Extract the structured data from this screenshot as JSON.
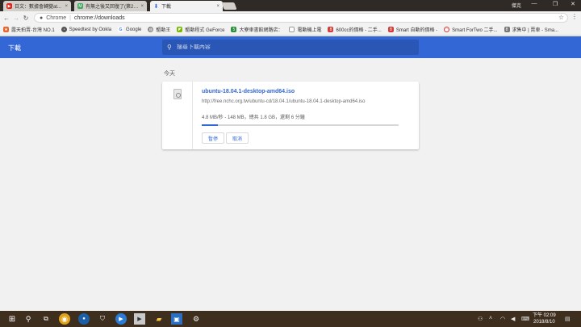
{
  "tabs": [
    {
      "label": "日文：數據會轉變at...",
      "icon": "youtube-icon",
      "color": "#e62117"
    },
    {
      "label": "有無之後又回復了(第2頁)",
      "icon": "forum-icon",
      "color": "#41a85f"
    },
    {
      "label": "下載",
      "icon": "download-icon",
      "color": "#3367d6"
    }
  ],
  "profile": "傑克",
  "address": {
    "scheme": "Chrome",
    "url": "chrome://downloads"
  },
  "bookmarks": [
    {
      "label": "露天拍賣-台灣 NO.1",
      "color": "#e8642c"
    },
    {
      "label": "Speedtest by Ookla",
      "color": "#555555"
    },
    {
      "label": "Google",
      "color": "#4285f4"
    },
    {
      "label": "驅動王",
      "color": "#888888"
    },
    {
      "label": "驅動程式 GeForce",
      "color": "#76b900"
    },
    {
      "label": "大寮車書館網路店：",
      "color": "#2a8f3a"
    },
    {
      "label": "電動機上電",
      "color": "#666666"
    },
    {
      "label": "600cc的價格 - 二手...",
      "color": "#d33b3b"
    },
    {
      "label": "Smart 自動的價格 -",
      "color": "#d33b3b"
    },
    {
      "label": "Smart ForTwo 二手...",
      "color": "#d33b3b"
    },
    {
      "label": "求售中 | 賣車 - Sma...",
      "color": "#777777"
    }
  ],
  "downloads": {
    "title": "下載",
    "search_placeholder": "搜尋下載內容",
    "date_label": "今天",
    "item": {
      "filename": "ubuntu-18.04.1-desktop-amd64.iso",
      "url": "http://free.nchc.org.tw/ubuntu-cd/18.04.1/ubuntu-18.04.1-desktop-amd64.iso",
      "status": "4.8 MB/秒 - 148 MB，總共 1.8 GB，還剩 6 分鐘",
      "progress": 0.08,
      "pause_label": "暫停",
      "cancel_label": "取消"
    }
  },
  "clock": {
    "time": "下午 02:09",
    "date": "2018/8/10"
  }
}
